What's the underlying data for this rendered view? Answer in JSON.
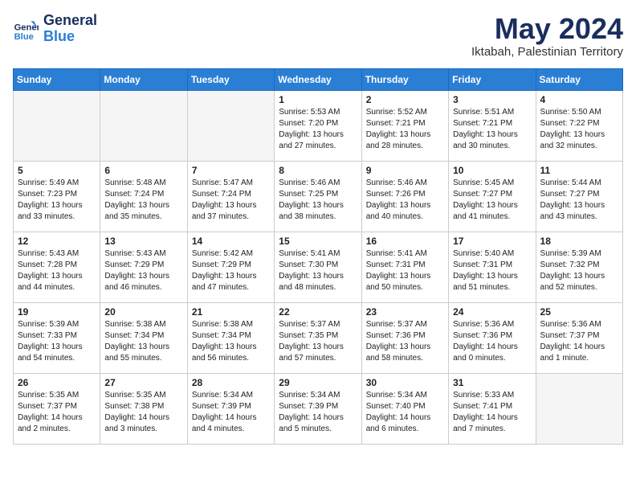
{
  "header": {
    "logo_line1": "General",
    "logo_line2": "Blue",
    "month_year": "May 2024",
    "location": "Iktabah, Palestinian Territory"
  },
  "weekdays": [
    "Sunday",
    "Monday",
    "Tuesday",
    "Wednesday",
    "Thursday",
    "Friday",
    "Saturday"
  ],
  "weeks": [
    [
      {
        "day": "",
        "info": ""
      },
      {
        "day": "",
        "info": ""
      },
      {
        "day": "",
        "info": ""
      },
      {
        "day": "1",
        "info": "Sunrise: 5:53 AM\nSunset: 7:20 PM\nDaylight: 13 hours\nand 27 minutes."
      },
      {
        "day": "2",
        "info": "Sunrise: 5:52 AM\nSunset: 7:21 PM\nDaylight: 13 hours\nand 28 minutes."
      },
      {
        "day": "3",
        "info": "Sunrise: 5:51 AM\nSunset: 7:21 PM\nDaylight: 13 hours\nand 30 minutes."
      },
      {
        "day": "4",
        "info": "Sunrise: 5:50 AM\nSunset: 7:22 PM\nDaylight: 13 hours\nand 32 minutes."
      }
    ],
    [
      {
        "day": "5",
        "info": "Sunrise: 5:49 AM\nSunset: 7:23 PM\nDaylight: 13 hours\nand 33 minutes."
      },
      {
        "day": "6",
        "info": "Sunrise: 5:48 AM\nSunset: 7:24 PM\nDaylight: 13 hours\nand 35 minutes."
      },
      {
        "day": "7",
        "info": "Sunrise: 5:47 AM\nSunset: 7:24 PM\nDaylight: 13 hours\nand 37 minutes."
      },
      {
        "day": "8",
        "info": "Sunrise: 5:46 AM\nSunset: 7:25 PM\nDaylight: 13 hours\nand 38 minutes."
      },
      {
        "day": "9",
        "info": "Sunrise: 5:46 AM\nSunset: 7:26 PM\nDaylight: 13 hours\nand 40 minutes."
      },
      {
        "day": "10",
        "info": "Sunrise: 5:45 AM\nSunset: 7:27 PM\nDaylight: 13 hours\nand 41 minutes."
      },
      {
        "day": "11",
        "info": "Sunrise: 5:44 AM\nSunset: 7:27 PM\nDaylight: 13 hours\nand 43 minutes."
      }
    ],
    [
      {
        "day": "12",
        "info": "Sunrise: 5:43 AM\nSunset: 7:28 PM\nDaylight: 13 hours\nand 44 minutes."
      },
      {
        "day": "13",
        "info": "Sunrise: 5:43 AM\nSunset: 7:29 PM\nDaylight: 13 hours\nand 46 minutes."
      },
      {
        "day": "14",
        "info": "Sunrise: 5:42 AM\nSunset: 7:29 PM\nDaylight: 13 hours\nand 47 minutes."
      },
      {
        "day": "15",
        "info": "Sunrise: 5:41 AM\nSunset: 7:30 PM\nDaylight: 13 hours\nand 48 minutes."
      },
      {
        "day": "16",
        "info": "Sunrise: 5:41 AM\nSunset: 7:31 PM\nDaylight: 13 hours\nand 50 minutes."
      },
      {
        "day": "17",
        "info": "Sunrise: 5:40 AM\nSunset: 7:31 PM\nDaylight: 13 hours\nand 51 minutes."
      },
      {
        "day": "18",
        "info": "Sunrise: 5:39 AM\nSunset: 7:32 PM\nDaylight: 13 hours\nand 52 minutes."
      }
    ],
    [
      {
        "day": "19",
        "info": "Sunrise: 5:39 AM\nSunset: 7:33 PM\nDaylight: 13 hours\nand 54 minutes."
      },
      {
        "day": "20",
        "info": "Sunrise: 5:38 AM\nSunset: 7:34 PM\nDaylight: 13 hours\nand 55 minutes."
      },
      {
        "day": "21",
        "info": "Sunrise: 5:38 AM\nSunset: 7:34 PM\nDaylight: 13 hours\nand 56 minutes."
      },
      {
        "day": "22",
        "info": "Sunrise: 5:37 AM\nSunset: 7:35 PM\nDaylight: 13 hours\nand 57 minutes."
      },
      {
        "day": "23",
        "info": "Sunrise: 5:37 AM\nSunset: 7:36 PM\nDaylight: 13 hours\nand 58 minutes."
      },
      {
        "day": "24",
        "info": "Sunrise: 5:36 AM\nSunset: 7:36 PM\nDaylight: 14 hours\nand 0 minutes."
      },
      {
        "day": "25",
        "info": "Sunrise: 5:36 AM\nSunset: 7:37 PM\nDaylight: 14 hours\nand 1 minute."
      }
    ],
    [
      {
        "day": "26",
        "info": "Sunrise: 5:35 AM\nSunset: 7:37 PM\nDaylight: 14 hours\nand 2 minutes."
      },
      {
        "day": "27",
        "info": "Sunrise: 5:35 AM\nSunset: 7:38 PM\nDaylight: 14 hours\nand 3 minutes."
      },
      {
        "day": "28",
        "info": "Sunrise: 5:34 AM\nSunset: 7:39 PM\nDaylight: 14 hours\nand 4 minutes."
      },
      {
        "day": "29",
        "info": "Sunrise: 5:34 AM\nSunset: 7:39 PM\nDaylight: 14 hours\nand 5 minutes."
      },
      {
        "day": "30",
        "info": "Sunrise: 5:34 AM\nSunset: 7:40 PM\nDaylight: 14 hours\nand 6 minutes."
      },
      {
        "day": "31",
        "info": "Sunrise: 5:33 AM\nSunset: 7:41 PM\nDaylight: 14 hours\nand 7 minutes."
      },
      {
        "day": "",
        "info": ""
      }
    ]
  ]
}
